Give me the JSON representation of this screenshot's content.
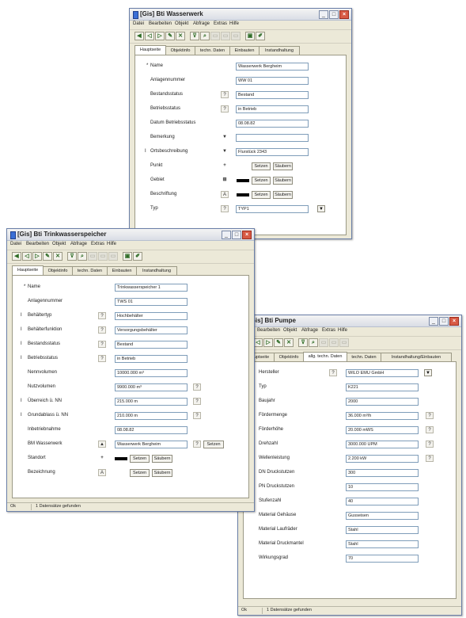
{
  "menu_labels": [
    "Datei",
    "Bearbeiten",
    "Objekt",
    "Abfrage",
    "Extras",
    "Hilfe"
  ],
  "w1": {
    "title": "[Gis] Bti Wasserwerk",
    "tabs": [
      "Hauptseite",
      "Objektinfo",
      "techn. Daten",
      "Einbauten",
      "Instandhaltung"
    ],
    "rows": [
      {
        "label": "Name",
        "required": "*",
        "value": "Wasserwerk Bergheim"
      },
      {
        "label": "Anlagennummer",
        "value": "WW 01"
      },
      {
        "label": "Bestandsstatus",
        "icon": "?",
        "value": "Bestand"
      },
      {
        "label": "Betriebsstatus",
        "icon": "?",
        "value": "in Betrieb"
      },
      {
        "label": "Datum Betriebsstatus",
        "value": "08.08.82"
      },
      {
        "label": "Bemerkung",
        "icon": "▼",
        "value": ""
      },
      {
        "label": "Ortsbeschreibung",
        "required": "I",
        "icon": "▼",
        "value": "Flurstück 2343"
      },
      {
        "label": "Punkt",
        "icon": "+"
      },
      {
        "label": "Gebiet",
        "icon": "⊞"
      },
      {
        "label": "Beschriftung",
        "icon": "A"
      },
      {
        "label": "Typ",
        "icon": "?",
        "value": "TYP1"
      }
    ],
    "set_label": "Setzen",
    "clear_label": "Säubern"
  },
  "w2": {
    "title": "[Gis] Bti Trinkwasserspeicher",
    "tabs": [
      "Hauptseite",
      "Objektinfo",
      "techn. Daten",
      "Einbauten",
      "Instandhaltung"
    ],
    "rows": [
      {
        "label": "Name",
        "required": "*",
        "value": "Trinkwasserspeicher 1"
      },
      {
        "label": "Anlagennummer",
        "value": "TWS 01"
      },
      {
        "label": "Behältertyp",
        "required": "I",
        "icon": "?",
        "value": "Hochbehälter"
      },
      {
        "label": "Behälterfunktion",
        "required": "I",
        "icon": "?",
        "value": "Versorgungsbehälter"
      },
      {
        "label": "Bestandsstatus",
        "required": "I",
        "icon": "?",
        "value": "Bestand"
      },
      {
        "label": "Betriebsstatus",
        "required": "I",
        "icon": "?",
        "value": "in Betrieb"
      },
      {
        "label": "Nennvolumen",
        "value": "10000.000 m³"
      },
      {
        "label": "Nutzvolumen",
        "value": "9900.000 m³",
        "aux": "?"
      },
      {
        "label": "Überreich ü. NN",
        "required": "I",
        "value": "215.000 m",
        "aux": "?"
      },
      {
        "label": "Grundablass ü. NN",
        "required": "I",
        "value": "210.000 m",
        "aux": "?"
      },
      {
        "label": "Inbetriebnahme",
        "value": "08.08.82"
      },
      {
        "label": "BM Wasserwerk",
        "icon": "▲",
        "value": "Wasserwerk Bergheim",
        "aux": "?",
        "extra": "Setzen"
      },
      {
        "label": "Standort",
        "icon": "+"
      },
      {
        "label": "Bezeichnung",
        "icon": "A"
      }
    ],
    "set_label": "Setzen",
    "clear_label": "Säubern",
    "status_ok": "Ok",
    "status_count": "1 Datensätze gefunden"
  },
  "w3": {
    "title": "[Gis] Bti Pumpe",
    "tabs": [
      "Hauptseite",
      "Objektinfo",
      "allg. techn. Daten",
      "techn. Daten",
      "Instandhaltung/Einbauten"
    ],
    "rows": [
      {
        "label": "Hersteller",
        "icon": "?",
        "value": "WILO EMU GmbH",
        "dropdown": "▼"
      },
      {
        "label": "Typ",
        "value": "K221"
      },
      {
        "label": "Baujahr",
        "value": "2000"
      },
      {
        "label": "Fördermenge",
        "value": "36.000 m³/h",
        "aux": "?"
      },
      {
        "label": "Förderhöhe",
        "value": "20.000 mWS",
        "aux": "?"
      },
      {
        "label": "Drehzahl",
        "value": "3000.000 UPM",
        "aux": "?"
      },
      {
        "label": "Wellenleistung",
        "value": "2.200 kW",
        "aux": "?"
      },
      {
        "label": "DN Druckstutzen",
        "value": "300"
      },
      {
        "label": "PN Druckstutzen",
        "value": "10"
      },
      {
        "label": "Stufenzahl",
        "value": "40"
      },
      {
        "label": "Material Gehäuse",
        "value": "Gusseisen"
      },
      {
        "label": "Material Laufräder",
        "value": "Stahl"
      },
      {
        "label": "Material Druckmantel",
        "value": "Stahl"
      },
      {
        "label": "Wirkungsgrad",
        "value": "70"
      }
    ],
    "status_ok": "Ok",
    "status_count": "1 Datensätze gefunden"
  }
}
